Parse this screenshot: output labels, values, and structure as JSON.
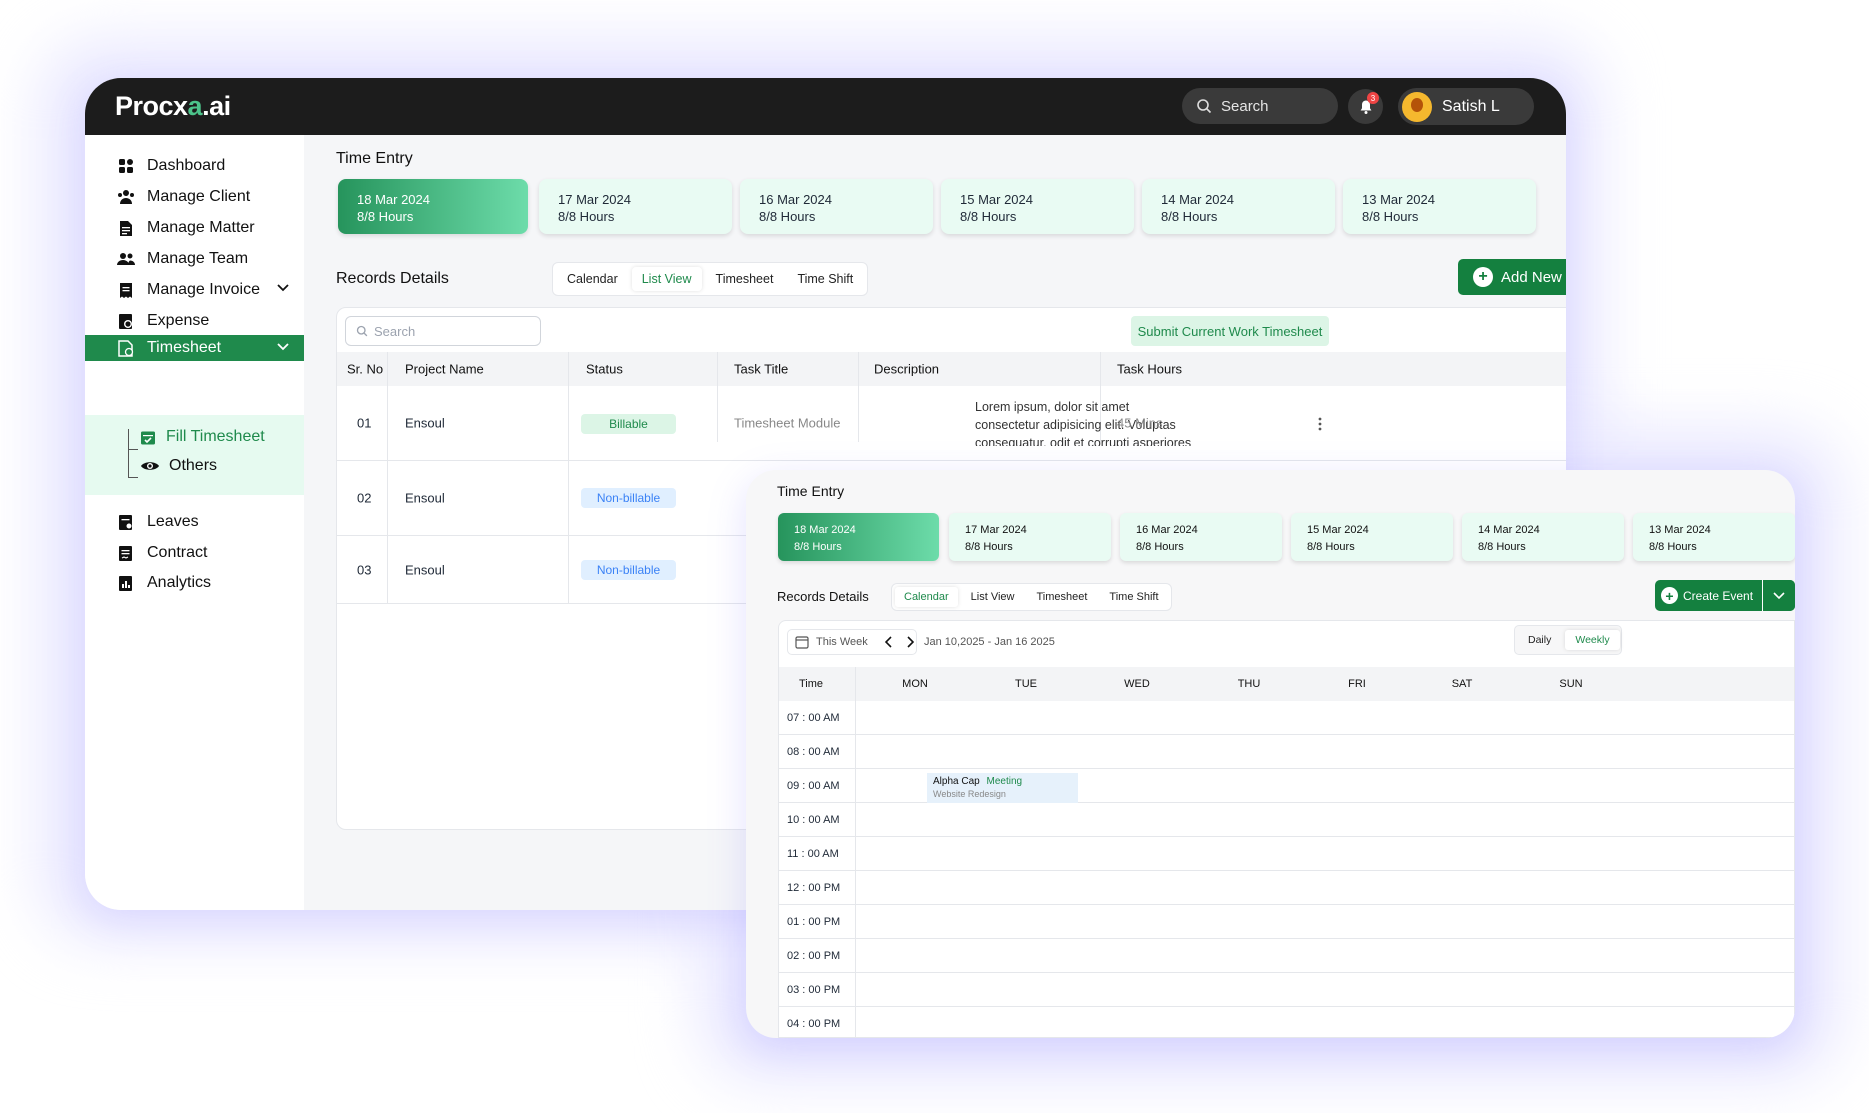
{
  "app": {
    "logo_main": "Procx",
    "logo_accent": "a",
    "logo_suffix": ".ai"
  },
  "topbar": {
    "search_label": "Search",
    "notification_count": "3",
    "user_name": "Satish L"
  },
  "sidebar": {
    "items": [
      {
        "label": "Dashboard",
        "icon": "dashboard-icon"
      },
      {
        "label": "Manage Client",
        "icon": "client-icon"
      },
      {
        "label": "Manage Matter",
        "icon": "matter-icon"
      },
      {
        "label": "Manage Team",
        "icon": "team-icon"
      },
      {
        "label": "Manage Invoice",
        "icon": "invoice-icon"
      },
      {
        "label": "Expense",
        "icon": "expense-icon"
      },
      {
        "label": "Timesheet",
        "icon": "timesheet-icon"
      },
      {
        "label": "Leaves",
        "icon": "leaves-icon"
      },
      {
        "label": "Contract",
        "icon": "contract-icon"
      },
      {
        "label": "Analytics",
        "icon": "analytics-icon"
      }
    ],
    "sub_items": [
      {
        "label": "Fill Timesheet",
        "icon": "calendar-check-icon"
      },
      {
        "label": "Others",
        "icon": "eye-icon"
      }
    ]
  },
  "main": {
    "title": "Time Entry",
    "dates": [
      {
        "date": "18 Mar 2024",
        "hours": "8/8 Hours"
      },
      {
        "date": "17 Mar 2024",
        "hours": "8/8 Hours"
      },
      {
        "date": "16 Mar 2024",
        "hours": "8/8 Hours"
      },
      {
        "date": "15 Mar 2024",
        "hours": "8/8 Hours"
      },
      {
        "date": "14 Mar 2024",
        "hours": "8/8 Hours"
      },
      {
        "date": "13 Mar 2024",
        "hours": "8/8 Hours"
      }
    ],
    "records_label": "Records Details",
    "tabs": [
      "Calendar",
      "List View",
      "Timesheet",
      "Time Shift"
    ],
    "active_tab": "List View",
    "add_task": "Add New Task",
    "search_placeholder": "Search",
    "submit_label": "Submit Current Work Timesheet",
    "columns": [
      "Sr. No",
      "Project Name",
      "Status",
      "Task Title",
      "Description",
      "Task Hours"
    ],
    "rows": [
      {
        "sr": "01",
        "project": "Ensoul",
        "status": "Billable",
        "task": "Timesheet Module",
        "desc": "Lorem ipsum, dolor sit amet consectetur adipisicing elit. Voluptas consequatur, odit et corrupti asperiores placeat magni labore nesciunt.",
        "hours": "45 Mins"
      },
      {
        "sr": "02",
        "project": "Ensoul",
        "status": "Non-billable"
      },
      {
        "sr": "03",
        "project": "Ensoul",
        "status": "Non-billable"
      }
    ]
  },
  "calendar_window": {
    "title": "Time Entry",
    "dates": [
      {
        "date": "18 Mar 2024",
        "hours": "8/8 Hours"
      },
      {
        "date": "17 Mar 2024",
        "hours": "8/8 Hours"
      },
      {
        "date": "16 Mar 2024",
        "hours": "8/8 Hours"
      },
      {
        "date": "15 Mar 2024",
        "hours": "8/8 Hours"
      },
      {
        "date": "14 Mar 2024",
        "hours": "8/8 Hours"
      },
      {
        "date": "13 Mar 2024",
        "hours": "8/8 Hours"
      }
    ],
    "records_label": "Records Details",
    "tabs": [
      "Calendar",
      "List View",
      "Timesheet",
      "Time Shift"
    ],
    "active_tab": "Calendar",
    "create_event": "Create Event",
    "this_week": "This Week",
    "range": "Jan 10,2025 - Jan 16 2025",
    "view_options": [
      "Daily",
      "Weekly"
    ],
    "active_view": "Weekly",
    "time_header": "Time",
    "days": [
      "MON",
      "TUE",
      "WED",
      "THU",
      "FRI",
      "SAT",
      "SUN"
    ],
    "times": [
      "07 : 00 AM",
      "08 : 00 AM",
      "09 : 00 AM",
      "10 : 00 AM",
      "11 : 00 AM",
      "12 : 00 PM",
      "01 : 00 PM",
      "02 : 00 PM",
      "03 : 00 PM",
      "04 : 00 PM"
    ],
    "event": {
      "title": "Alpha Cap",
      "tag": "Meeting",
      "subtitle": "Website Redesign"
    }
  },
  "colors": {
    "brand_green": "#1f8a4c",
    "topbar": "#1c1c1c",
    "date_card": "#e9fbf3"
  }
}
